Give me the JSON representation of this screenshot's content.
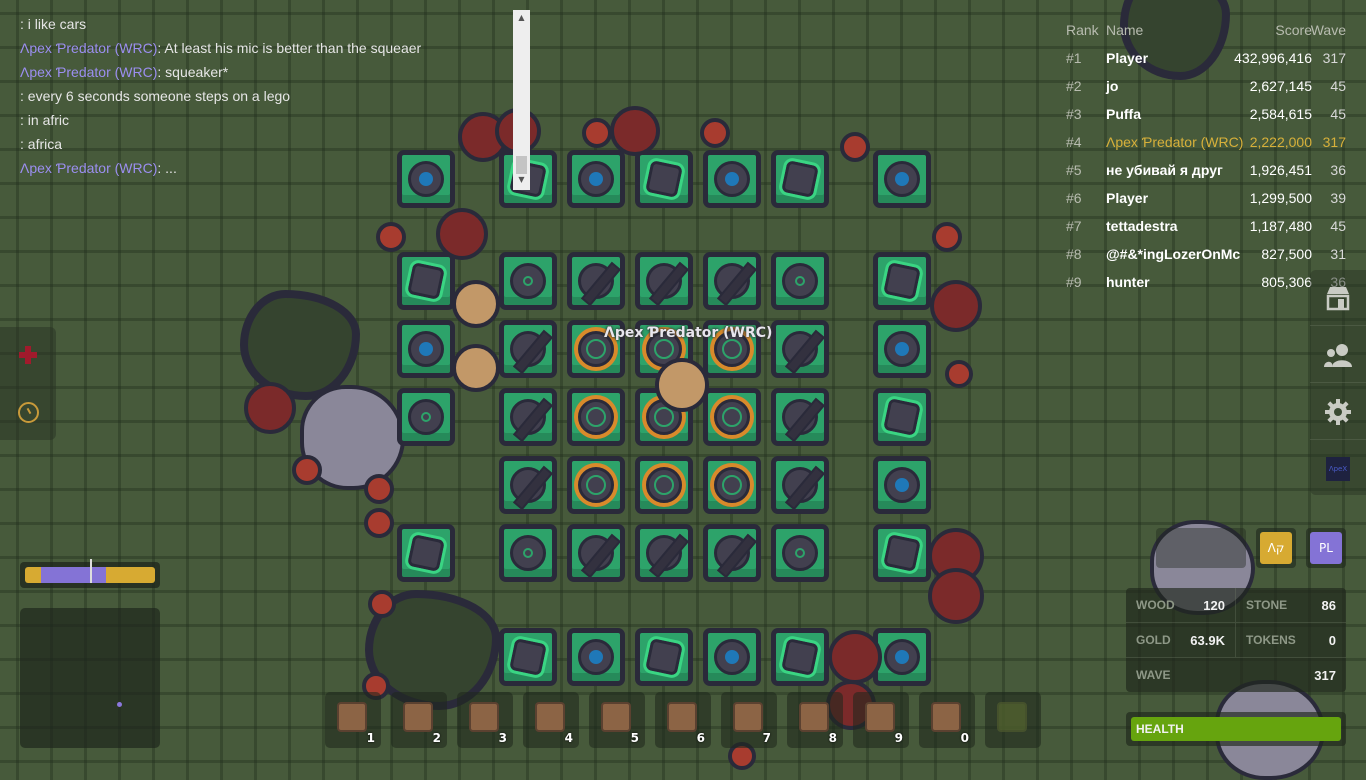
{
  "chat": {
    "messages": [
      {
        "name": "",
        "text": ": i like cars"
      },
      {
        "name": "Λpex Ƥredator (WRC)",
        "text": ": At least his mic is better than the squeaer"
      },
      {
        "name": "Λpex Ƥredator (WRC)",
        "text": ": squeaker*"
      },
      {
        "name": "",
        "text": ": every 6 seconds someone steps on a lego"
      },
      {
        "name": "",
        "text": ": in afric"
      },
      {
        "name": "",
        "text": ": africa"
      },
      {
        "name": "Λpex Ƥredator (WRC)",
        "text": ": ..."
      }
    ],
    "scroll_up": "▲",
    "scroll_down": "▼"
  },
  "leaderboard": {
    "headers": {
      "rank": "Rank",
      "name": "Name",
      "score": "Score",
      "wave": "Wave"
    },
    "rows": [
      {
        "rank": "#1",
        "name": "Player",
        "score": "432,996,416",
        "wave": "317",
        "me": false
      },
      {
        "rank": "#2",
        "name": "jo",
        "score": "2,627,145",
        "wave": "45",
        "me": false
      },
      {
        "rank": "#3",
        "name": "Puffa",
        "score": "2,584,615",
        "wave": "45",
        "me": false
      },
      {
        "rank": "#4",
        "name": "Λpex Ƥredator (WRC)",
        "score": "2,222,000",
        "wave": "317",
        "me": true
      },
      {
        "rank": "#5",
        "name": "не убивай я друг",
        "score": "1,926,451",
        "wave": "36",
        "me": false
      },
      {
        "rank": "#6",
        "name": "Player",
        "score": "1,299,500",
        "wave": "39",
        "me": false
      },
      {
        "rank": "#7",
        "name": "tettadestra",
        "score": "1,187,480",
        "wave": "45",
        "me": false
      },
      {
        "rank": "#8",
        "name": "@#&*ingLozerOnMc",
        "score": "827,500",
        "wave": "31",
        "me": false
      },
      {
        "rank": "#9",
        "name": "hunter",
        "score": "805,306",
        "wave": "36",
        "me": false
      }
    ]
  },
  "player": {
    "name": "Λpex Ƥredator (WRC)"
  },
  "side_menu": [
    {
      "id": "shop",
      "icon": "shop-icon",
      "glyph": "⌂"
    },
    {
      "id": "party",
      "icon": "party-icon",
      "glyph": "👥"
    },
    {
      "id": "settings",
      "icon": "gear-icon",
      "glyph": "⚙"
    },
    {
      "id": "logo",
      "icon": "apex-logo-icon",
      "glyph": "ΛpeX"
    }
  ],
  "left_menu": [
    {
      "id": "heal",
      "icon": "red-cross-icon"
    },
    {
      "id": "day-timer",
      "icon": "clock-icon"
    }
  ],
  "day_cycle": {
    "night_start": 0.12,
    "night_end": 0.62,
    "position": 0.5
  },
  "minimap": {
    "player_x": 0.69,
    "player_y": 0.67
  },
  "hotbar": [
    {
      "key": "1",
      "item": "wall"
    },
    {
      "key": "2",
      "item": "door"
    },
    {
      "key": "3",
      "item": "slow-trap"
    },
    {
      "key": "4",
      "item": "arrow-tower"
    },
    {
      "key": "5",
      "item": "cannon-tower"
    },
    {
      "key": "6",
      "item": "melee-tower"
    },
    {
      "key": "7",
      "item": "mage-tower"
    },
    {
      "key": "8",
      "item": "bomb-tower"
    },
    {
      "key": "9",
      "item": "gold-mine"
    },
    {
      "key": "0",
      "item": "harvester"
    },
    {
      "key": "",
      "item": "locked-slot"
    }
  ],
  "party": [
    {
      "label": "Λק",
      "color": "#d7aa32"
    },
    {
      "label": "PL",
      "color": "#8473d6"
    }
  ],
  "resources": {
    "wood": {
      "label": "WOOD",
      "value": "120"
    },
    "stone": {
      "label": "STONE",
      "value": "86"
    },
    "gold": {
      "label": "GOLD",
      "value": "63.9K"
    },
    "tokens": {
      "label": "TOKENS",
      "value": "0"
    },
    "wave": {
      "label": "WAVE",
      "value": "317"
    }
  },
  "health": {
    "label": "HEALTH",
    "fraction": 1.0,
    "color": "#66a40e"
  }
}
